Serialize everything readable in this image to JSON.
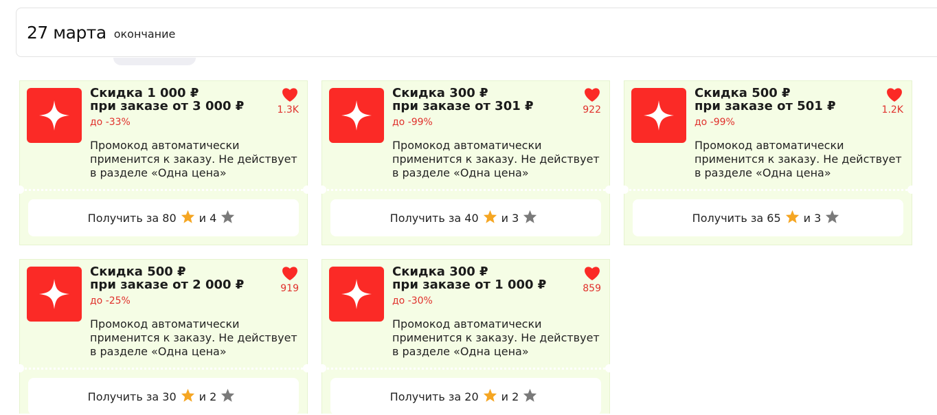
{
  "header": {
    "date": "27 марта",
    "subtitle": "окончание"
  },
  "colors": {
    "brand_red": "#fb2a26",
    "accent_red": "#e0302b",
    "card_bg": "#f5fde5",
    "gold_star": "#f5a623",
    "gray_star": "#7a7a7a"
  },
  "cards": [
    {
      "title_line1": "Скидка 1 000 ₽",
      "title_line2": "при заказе от 3 000 ₽",
      "discount": "до -33%",
      "likes": "1.3K",
      "description": "Промокод автоматически применится к заказу. Не действует в разделе «Одна цена»",
      "button": {
        "prefix": "Получить за 80",
        "middle": "и 4"
      }
    },
    {
      "title_line1": "Скидка 300 ₽",
      "title_line2": "при заказе от 301 ₽",
      "discount": "до -99%",
      "likes": "922",
      "description": "Промокод автоматически применится к заказу. Не действует в разделе «Одна цена»",
      "button": {
        "prefix": "Получить за 40",
        "middle": "и 3"
      }
    },
    {
      "title_line1": "Скидка 500 ₽",
      "title_line2": "при заказе от 501 ₽",
      "discount": "до -99%",
      "likes": "1.2K",
      "description": "Промокод автоматически применится к заказу. Не действует в разделе «Одна цена»",
      "button": {
        "prefix": "Получить за 65",
        "middle": "и 3"
      }
    },
    {
      "title_line1": "Скидка 500 ₽",
      "title_line2": "при заказе от 2 000 ₽",
      "discount": "до -25%",
      "likes": "919",
      "description": "Промокод автоматически применится к заказу. Не действует в разделе «Одна цена»",
      "button": {
        "prefix": "Получить за 30",
        "middle": "и 2"
      }
    },
    {
      "title_line1": "Скидка 300 ₽",
      "title_line2": "при заказе от 1 000 ₽",
      "discount": "до -30%",
      "likes": "859",
      "description": "Промокод автоматически применится к заказу. Не действует в разделе «Одна цена»",
      "button": {
        "prefix": "Получить за 20",
        "middle": "и 2"
      }
    }
  ]
}
